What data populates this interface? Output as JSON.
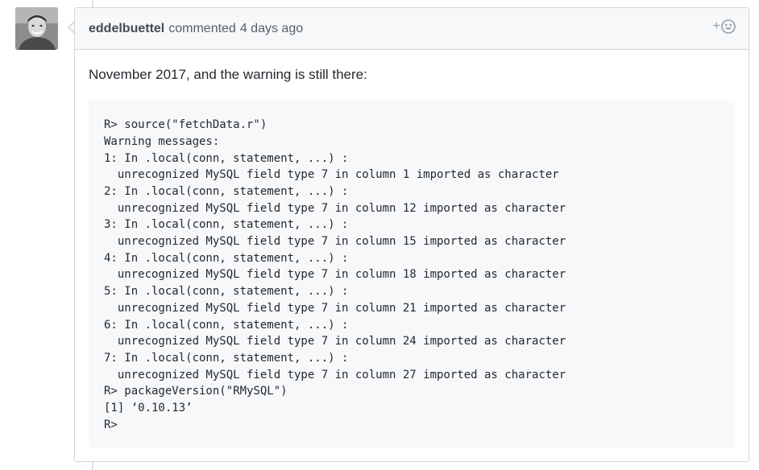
{
  "comment": {
    "author": "eddelbuettel",
    "action": "commented",
    "timestamp": "4 days ago",
    "reaction_plus": "+",
    "body_text": "November 2017, and the warning is still there:",
    "code_lines": [
      "R> source(\"fetchData.r\")",
      "Warning messages:",
      "1: In .local(conn, statement, ...) :",
      "  unrecognized MySQL field type 7 in column 1 imported as character",
      "2: In .local(conn, statement, ...) :",
      "  unrecognized MySQL field type 7 in column 12 imported as character",
      "3: In .local(conn, statement, ...) :",
      "  unrecognized MySQL field type 7 in column 15 imported as character",
      "4: In .local(conn, statement, ...) :",
      "  unrecognized MySQL field type 7 in column 18 imported as character",
      "5: In .local(conn, statement, ...) :",
      "  unrecognized MySQL field type 7 in column 21 imported as character",
      "6: In .local(conn, statement, ...) :",
      "  unrecognized MySQL field type 7 in column 24 imported as character",
      "7: In .local(conn, statement, ...) :",
      "  unrecognized MySQL field type 7 in column 27 imported as character",
      "R> packageVersion(\"RMySQL\")",
      "[1] ‘0.10.13’",
      "R> "
    ]
  },
  "icons": {
    "avatar": "user-avatar",
    "reaction": "smiley-icon"
  },
  "colors": {
    "header_bg": "#f6f8fa",
    "border": "#d1d5da",
    "code_bg": "#f6f8fa",
    "muted": "#586069"
  }
}
